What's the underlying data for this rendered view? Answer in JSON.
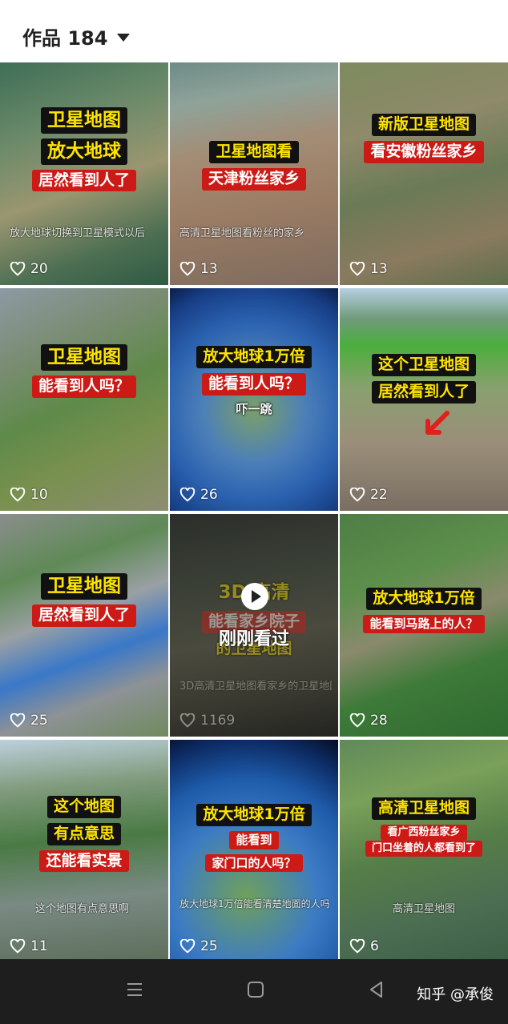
{
  "header": {
    "title": "作品 184"
  },
  "tiles": [
    {
      "captions": [
        "卫星地图",
        "放大地球",
        "居然看到人了"
      ],
      "subtitle": "放大地球切换到卫星模式以后",
      "likes": "20"
    },
    {
      "captions": [
        "卫星地图看",
        "天津粉丝家乡"
      ],
      "subtitle": "高清卫星地图看粉丝的家乡",
      "likes": "13"
    },
    {
      "captions": [
        "新版卫星地图",
        "看安徽粉丝家乡"
      ],
      "subtitle": "",
      "likes": "13"
    },
    {
      "captions": [
        "卫星地图",
        "能看到人吗？"
      ],
      "subtitle": "",
      "likes": "10"
    },
    {
      "captions": [
        "放大地球1万倍",
        "能看到人吗？",
        "吓一跳"
      ],
      "subtitle": "",
      "likes": "26"
    },
    {
      "captions": [
        "这个卫星地图",
        "居然看到人了"
      ],
      "subtitle": "",
      "likes": "22"
    },
    {
      "captions": [
        "卫星地图",
        "居然看到人了"
      ],
      "subtitle": "",
      "likes": "25"
    },
    {
      "captions": [
        "3D 高清",
        "能看家乡院子",
        "的卫星地图"
      ],
      "subtitle": "3D高清卫星地图看家乡的卫星地图",
      "likes": "1169",
      "overlay": "刚刚看过"
    },
    {
      "captions": [
        "放大地球1万倍",
        "能看到马路上的人？"
      ],
      "subtitle": "",
      "likes": "28"
    },
    {
      "captions": [
        "这个地图",
        "有点意思",
        "还能看实景"
      ],
      "subtitle": "这个地图有点意思啊",
      "likes": "11"
    },
    {
      "captions": [
        "放大地球1万倍",
        "能看到",
        "家门口的人吗？"
      ],
      "subtitle": "放大地球1万倍能看清楚地面的人吗",
      "likes": "25"
    },
    {
      "captions": [
        "高清卫星地图",
        "看广西粉丝家乡",
        "门口坐着的人都看到了"
      ],
      "subtitle": "高清卫星地图",
      "likes": "6"
    }
  ],
  "navbar": {
    "watermark": "知乎 @承俊"
  }
}
